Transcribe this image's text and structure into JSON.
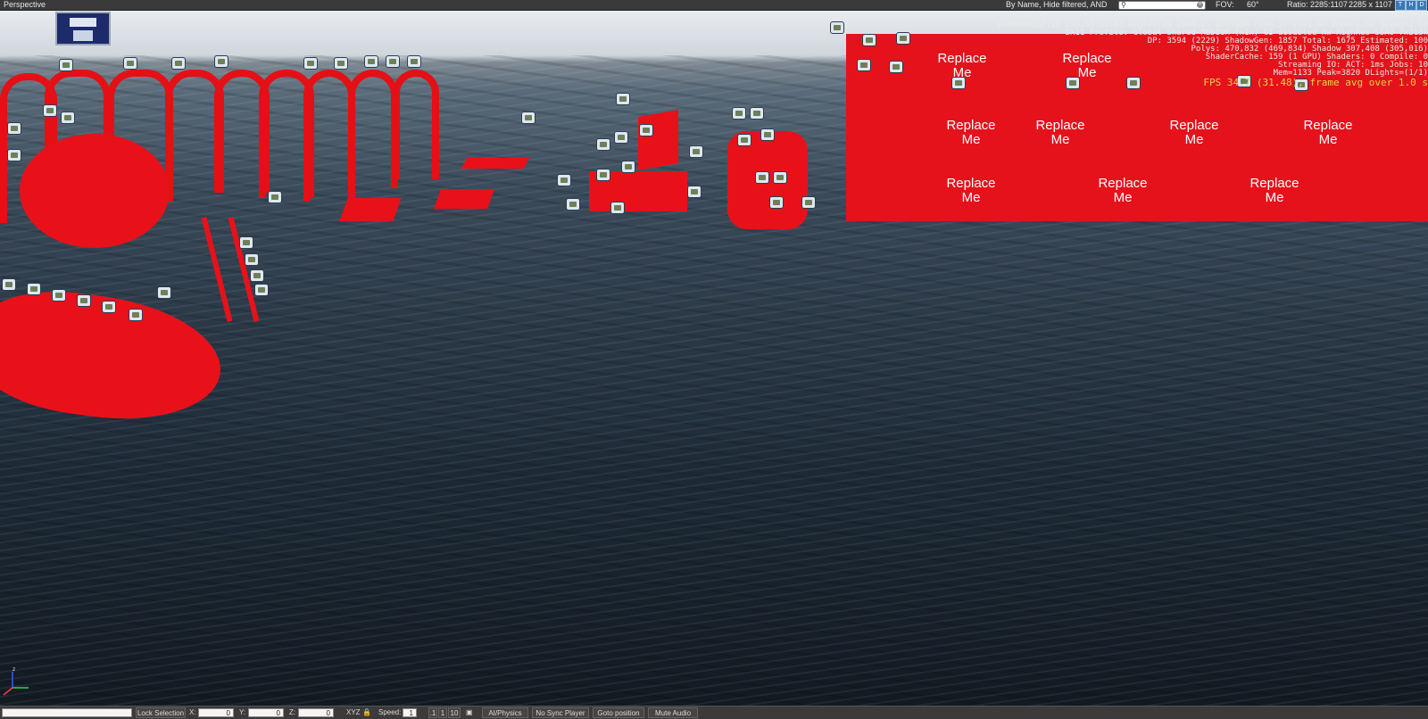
{
  "window": {
    "title": "Perspective"
  },
  "toolbar": {
    "filter_label": "By Name, Hide filtered, AND",
    "search_placeholder": "",
    "fov_label": "FOV:",
    "fov_value": "60°",
    "ratio_label": "Ratio: 2285:1107",
    "resolution": "2285 x 1107",
    "buttons": [
      "T",
      "H",
      "D"
    ]
  },
  "stats": {
    "lines": [
      "CamPos=282.10 193.53 51.03 Angle=-26    ZN=0.25 ZF=7988 PC=0.37 VS=1.00 Zoom=1.00 Speed=1.00",
      "DX11 Profile: Global Shared MEDIUM (x1x) GI disabled Hw HighRes SSAO 7x213k",
      "DP: 3594 (2229) ShadowGen: 1857 Total: 1675 Estimated: 100",
      "Polys: 470,832 (469,834) Shadow 307,408 (305,016)",
      "ShaderCache: 159 (1 GPU) Shaders: 0 Compile: 0",
      "Streaming IO: ACT: 1ms Jobs: 10",
      "Mem=1133 Peak=3820 DLights=(1/1)",
      "FPS 34.7 (31.48), frame avg over 1.0 s"
    ],
    "fps_color": "#e6d44a"
  },
  "scene": {
    "decal_text": "Replace Me",
    "building_color": "#e5121b",
    "water_color": "#1d2a36"
  },
  "statusbar": {
    "lock_selection": "Lock Selection",
    "x_label": "X:",
    "x_value": "0",
    "y_label": "Y:",
    "y_value": "0",
    "z_label": "Z:",
    "z_value": "0",
    "xyz_label": "XYZ",
    "speed_label": "Speed:",
    "speed_value": "1",
    "speed_presets": [
      ".1",
      "1",
      "10"
    ],
    "ai_physics": "AI/Physics",
    "no_sync_player": "No Sync Player",
    "goto_position": "Goto position",
    "mute_audio": "Mute Audio"
  }
}
